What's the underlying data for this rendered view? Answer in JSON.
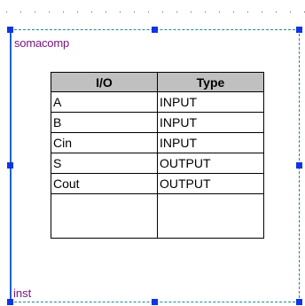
{
  "block": {
    "name": "somacomp",
    "instance_label": "inst",
    "colors": {
      "label": "#7a1680",
      "border": "#1f8a8a",
      "handle": "#1234e0",
      "header_bg": "#c0c0c0"
    }
  },
  "port_table": {
    "headers": {
      "io": "I/O",
      "type": "Type"
    },
    "rows": [
      {
        "io": "A",
        "type": "INPUT"
      },
      {
        "io": "B",
        "type": "INPUT"
      },
      {
        "io": "Cin",
        "type": "INPUT"
      },
      {
        "io": "S",
        "type": "OUTPUT"
      },
      {
        "io": "Cout",
        "type": "OUTPUT"
      }
    ]
  }
}
